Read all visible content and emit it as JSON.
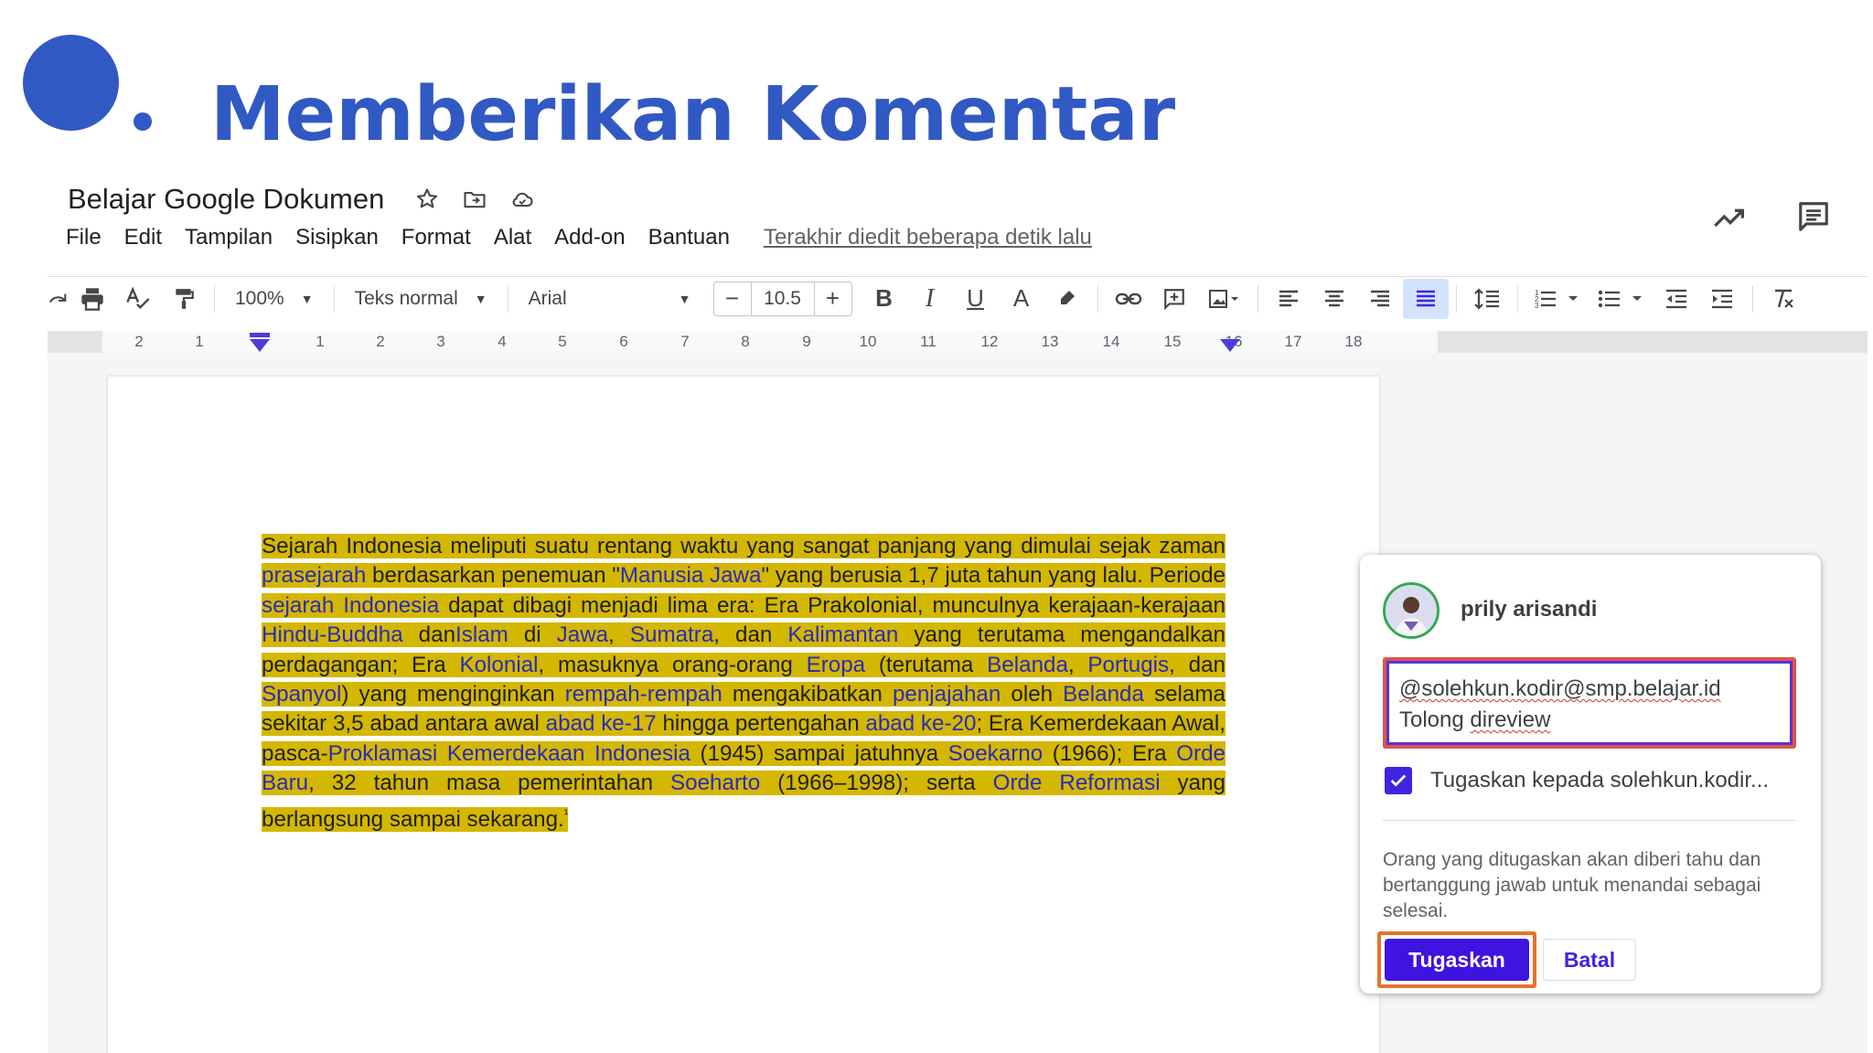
{
  "slide": {
    "title": "Memberikan Komentar",
    "accent_color": "#3159c4"
  },
  "document": {
    "title": "Belajar Google Dokumen",
    "title_icons": [
      "star-icon",
      "move-to-folder-icon",
      "cloud-status-icon"
    ],
    "menu": [
      "File",
      "Edit",
      "Tampilan",
      "Sisipkan",
      "Format",
      "Alat",
      "Add-on",
      "Bantuan"
    ],
    "last_edit": "Terakhir diedit beberapa detik lalu",
    "top_right_icons": [
      "activity-trend-icon",
      "comment-history-icon"
    ]
  },
  "toolbar": {
    "zoom": "100%",
    "style": "Teks normal",
    "font": "Arial",
    "font_size": "10.5",
    "minus": "−",
    "plus": "+",
    "bold": "B",
    "italic": "I",
    "underline": "U",
    "text_color": "A"
  },
  "ruler": {
    "labels": [
      "2",
      "1",
      "1",
      "2",
      "3",
      "4",
      "5",
      "6",
      "7",
      "8",
      "9",
      "10",
      "11",
      "12",
      "13",
      "14",
      "15",
      "16",
      "17",
      "18"
    ]
  },
  "content": {
    "segments": [
      {
        "t": "Sejarah Indonesia meliputi suatu rentang waktu yang sangat panjang yang dimulai sejak zaman ",
        "link": false
      },
      {
        "t": "prasejarah",
        "link": true
      },
      {
        "t": " berdasarkan penemuan \"",
        "link": false
      },
      {
        "t": "Manusia Jawa",
        "link": true
      },
      {
        "t": "\" yang berusia 1,7 juta tahun yang lalu. Periode ",
        "link": false
      },
      {
        "t": "sejarah Indonesia",
        "link": true
      },
      {
        "t": " dapat dibagi menjadi lima era: Era Prakolonial, munculnya kerajaan-kerajaan ",
        "link": false
      },
      {
        "t": "Hindu-Buddha",
        "link": true
      },
      {
        "t": " dan",
        "link": false
      },
      {
        "t": "Islam",
        "link": true
      },
      {
        "t": " di ",
        "link": false
      },
      {
        "t": "Jawa",
        "link": true
      },
      {
        "t": ", ",
        "link": false
      },
      {
        "t": "Sumatra",
        "link": true
      },
      {
        "t": ", dan ",
        "link": false
      },
      {
        "t": "Kalimantan",
        "link": true
      },
      {
        "t": " yang terutama mengandalkan perdagangan; Era ",
        "link": false
      },
      {
        "t": "Kolonial",
        "link": true
      },
      {
        "t": ", masuknya orang-orang ",
        "link": false
      },
      {
        "t": "Eropa",
        "link": true
      },
      {
        "t": " (terutama ",
        "link": false
      },
      {
        "t": "Belanda",
        "link": true
      },
      {
        "t": ", ",
        "link": false
      },
      {
        "t": "Portugis",
        "link": true
      },
      {
        "t": ", dan ",
        "link": false
      },
      {
        "t": "Spanyol",
        "link": true
      },
      {
        "t": ") yang menginginkan ",
        "link": false
      },
      {
        "t": "rempah-rempah",
        "link": true
      },
      {
        "t": " mengakibatkan ",
        "link": false
      },
      {
        "t": "penjajahan",
        "link": true
      },
      {
        "t": " oleh ",
        "link": false
      },
      {
        "t": "Belanda",
        "link": true
      },
      {
        "t": " selama sekitar 3,5 abad antara awal ",
        "link": false
      },
      {
        "t": "abad ke-17",
        "link": true
      },
      {
        "t": " hingga pertengahan ",
        "link": false
      },
      {
        "t": "abad ke-20",
        "link": true
      },
      {
        "t": "; Era Kemerdekaan Awal, pasca-",
        "link": false
      },
      {
        "t": "Proklamasi Kemerdekaan Indonesia",
        "link": true
      },
      {
        "t": " (1945) sampai jatuhnya ",
        "link": false
      },
      {
        "t": "Soekarno",
        "link": true
      },
      {
        "t": " (1966); Era ",
        "link": false
      },
      {
        "t": "Orde Baru",
        "link": true
      },
      {
        "t": ", 32 tahun masa pemerintahan ",
        "link": false
      },
      {
        "t": "Soeharto",
        "link": true
      },
      {
        "t": " (1966–1998); serta ",
        "link": false
      },
      {
        "t": "Orde Reformasi",
        "link": true
      },
      {
        "t": " yang berlangsung sampai sekarang.",
        "link": false
      },
      {
        "t": "¹",
        "link": false
      }
    ],
    "highlight_color": "#d4b700",
    "link_color": "#2b2bb8"
  },
  "comment": {
    "author": "prily arisandi",
    "text_line1": "@solehkun.kodir@smp.belajar.id",
    "text_line2_a": "Tolong ",
    "text_line2_b": "direview",
    "assign_label": "Tugaskan kepada solehkun.kodir...",
    "assign_checked": true,
    "note": "Orang yang ditugaskan akan diberi tahu dan bertanggung jawab untuk menandai sebagai selesai.",
    "assign_button": "Tugaskan",
    "cancel_button": "Batal",
    "primary_color": "#3f13e0",
    "highlight_frame_color": "#e8722a"
  }
}
